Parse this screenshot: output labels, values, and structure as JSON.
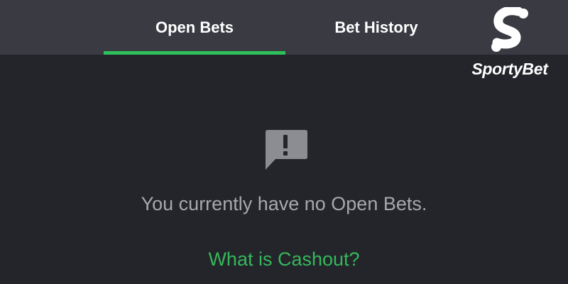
{
  "tabs": [
    {
      "label": "Open Bets",
      "active": true
    },
    {
      "label": "Bet History",
      "active": false
    }
  ],
  "brand": {
    "name": "SportyBet"
  },
  "empty_state": {
    "icon": "alert-message-icon",
    "message": "You currently have no Open Bets.",
    "link_label": "What is Cashout?"
  },
  "colors": {
    "background": "#24252b",
    "tab_bar": "#393a42",
    "accent_green": "#2fbf5b",
    "message_text": "#a7a8ad",
    "icon_gray": "#8c8d93"
  }
}
